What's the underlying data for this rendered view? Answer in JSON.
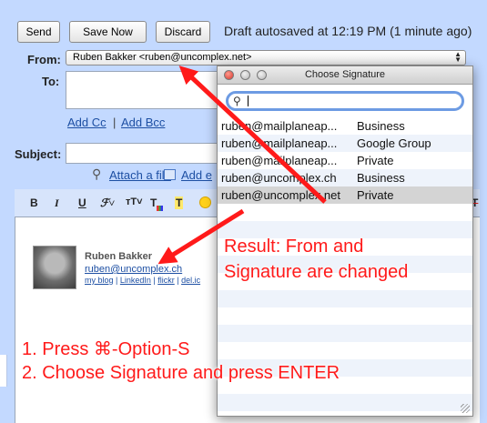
{
  "toolbar": {
    "send_label": "Send",
    "save_label": "Save Now",
    "discard_label": "Discard",
    "draft_status": "Draft autosaved at 12:19 PM (1 minute ago)"
  },
  "header": {
    "from_label": "From:",
    "from_value": "Ruben Bakker <ruben@uncomplex.net>",
    "to_label": "To:",
    "add_cc": "Add Cc",
    "add_bcc": "Add Bcc",
    "separator": "|",
    "subject_label": "Subject:",
    "attach_label": "Attach a file",
    "add_event_label": "Add e"
  },
  "format_toolbar": {
    "bold": "B",
    "italic": "I",
    "underline": "U",
    "font": "ℱ˅",
    "size": "тT˅",
    "text_color": "T",
    "highlight": "T",
    "remove_format": "T"
  },
  "signature": {
    "name": "Ruben Bakker",
    "email": "ruben@uncomplex.ch",
    "links": [
      "my blog",
      "LinkedIn",
      "flickr",
      "del.ic"
    ]
  },
  "dialog": {
    "title": "Choose Signature",
    "search_value": "",
    "items": [
      {
        "email": "ruben@mailplaneap...",
        "category": "Business"
      },
      {
        "email": "ruben@mailplaneap...",
        "category": "Google Group"
      },
      {
        "email": "ruben@mailplaneap...",
        "category": "Private"
      },
      {
        "email": "ruben@uncomplex.ch",
        "category": "Business"
      },
      {
        "email": "ruben@uncomplex.net",
        "category": "Private"
      }
    ],
    "selected_index": 4
  },
  "annotations": {
    "result_line1": "Result: From and",
    "result_line2": "Signature are changed",
    "step1": "1. Press ⌘-Option-S",
    "step2": "2. Choose Signature and press ENTER"
  },
  "colors": {
    "accent": "#c3d9ff",
    "link": "#1d4fa3",
    "annotation": "#ff1a1a",
    "selected_row": "#d4d4d4",
    "stripe": "#eef3fb"
  }
}
